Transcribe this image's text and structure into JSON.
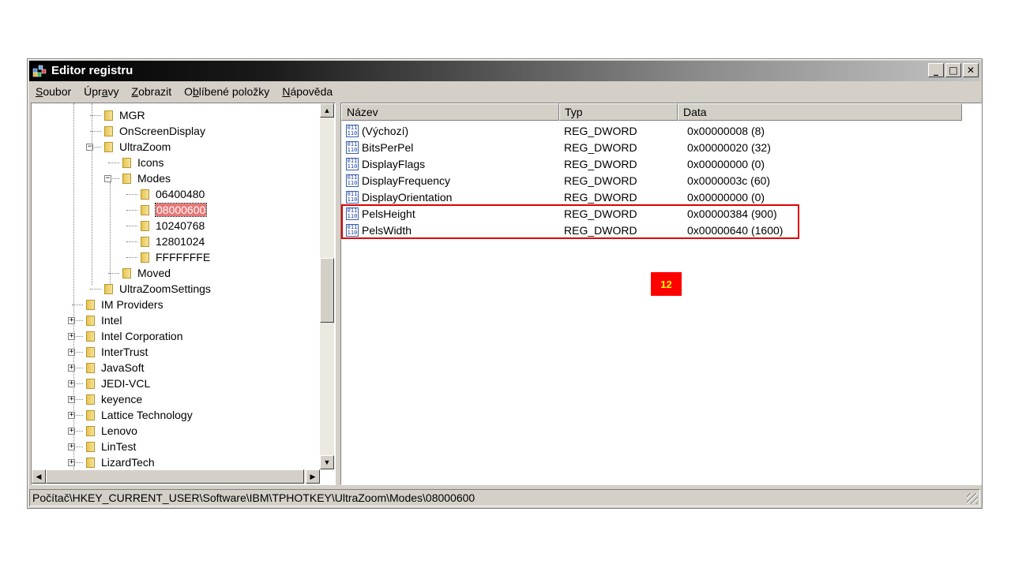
{
  "window": {
    "title": "Editor registru",
    "controls": {
      "minimize": "_",
      "maximize": "□",
      "close": "✕"
    }
  },
  "menu": [
    {
      "pre": "",
      "ul": "S",
      "post": "oubor"
    },
    {
      "pre": "Úpr",
      "ul": "a",
      "post": "vy"
    },
    {
      "pre": "",
      "ul": "Z",
      "post": "obrazit"
    },
    {
      "pre": "O",
      "ul": "b",
      "post": "líbené položky"
    },
    {
      "pre": "",
      "ul": "N",
      "post": "ápověda"
    }
  ],
  "tree": {
    "items": [
      {
        "label": "MGR"
      },
      {
        "label": "OnScreenDisplay"
      },
      {
        "label": "UltraZoom",
        "expander": "−"
      },
      {
        "label": "Icons"
      },
      {
        "label": "Modes",
        "expander": "−"
      },
      {
        "label": "06400480"
      },
      {
        "label": "08000600",
        "selected": true
      },
      {
        "label": "10240768"
      },
      {
        "label": "12801024"
      },
      {
        "label": "FFFFFFFE"
      },
      {
        "label": "Moved"
      },
      {
        "label": "UltraZoomSettings"
      },
      {
        "label": "IM Providers"
      },
      {
        "label": "Intel",
        "expander": "+"
      },
      {
        "label": "Intel Corporation",
        "expander": "+"
      },
      {
        "label": "InterTrust",
        "expander": "+"
      },
      {
        "label": "JavaSoft",
        "expander": "+"
      },
      {
        "label": "JEDI-VCL",
        "expander": "+"
      },
      {
        "label": "keyence",
        "expander": "+"
      },
      {
        "label": "Lattice Technology",
        "expander": "+"
      },
      {
        "label": "Lenovo",
        "expander": "+"
      },
      {
        "label": "LinTest",
        "expander": "+"
      },
      {
        "label": "LizardTech",
        "expander": "+"
      }
    ]
  },
  "list": {
    "columns": [
      "Název",
      "Typ",
      "Data"
    ],
    "rows": [
      {
        "name": "(Výchozí)",
        "type": "REG_DWORD",
        "data": "0x00000008 (8)"
      },
      {
        "name": "BitsPerPel",
        "type": "REG_DWORD",
        "data": "0x00000020 (32)"
      },
      {
        "name": "DisplayFlags",
        "type": "REG_DWORD",
        "data": "0x00000000 (0)"
      },
      {
        "name": "DisplayFrequency",
        "type": "REG_DWORD",
        "data": "0x0000003c (60)"
      },
      {
        "name": "DisplayOrientation",
        "type": "REG_DWORD",
        "data": "0x00000000 (0)"
      },
      {
        "name": "PelsHeight",
        "type": "REG_DWORD",
        "data": "0x00000384 (900)"
      },
      {
        "name": "PelsWidth",
        "type": "REG_DWORD",
        "data": "0x00000640 (1600)"
      }
    ],
    "icon_text": "011\n110"
  },
  "annotation": {
    "badge": "12",
    "highlight_color": "#e00000",
    "badge_color": "#ff0000"
  },
  "statusbar": {
    "path": "Počítač\\HKEY_CURRENT_USER\\Software\\IBM\\TPHOTKEY\\UltraZoom\\Modes\\08000600"
  }
}
